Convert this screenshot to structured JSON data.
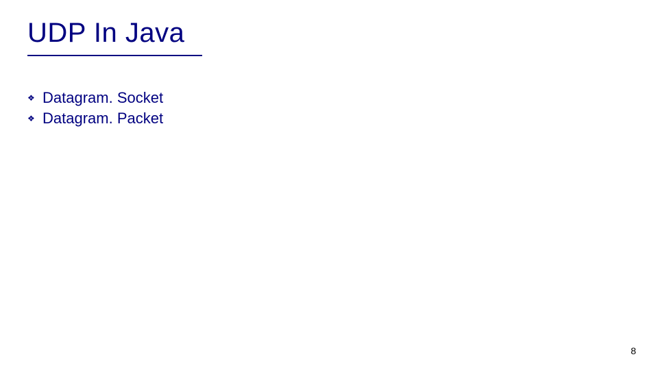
{
  "slide": {
    "title": "UDP In Java",
    "bullets": [
      {
        "text": "Datagram. Socket"
      },
      {
        "text": "Datagram. Packet"
      }
    ],
    "page_number": "8",
    "bullet_glyph": "❖",
    "accent_color": "#000080"
  }
}
